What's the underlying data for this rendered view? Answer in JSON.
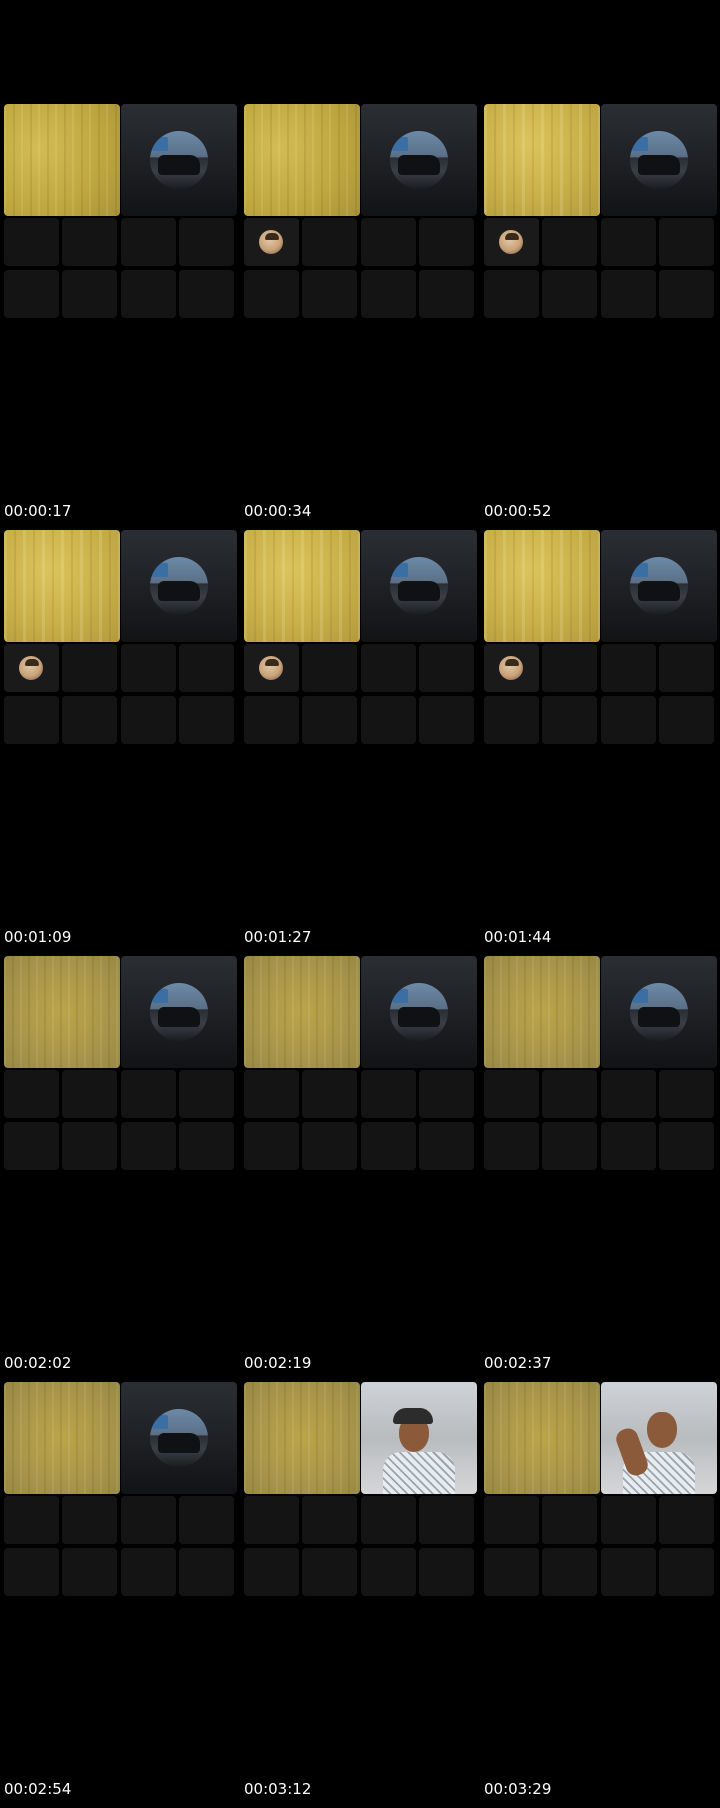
{
  "frames": [
    {
      "timestamp": "00:00:17",
      "remote_view": "avatar",
      "participant_avatar": false
    },
    {
      "timestamp": "00:00:34",
      "remote_view": "avatar",
      "participant_avatar": true
    },
    {
      "timestamp": "00:00:52",
      "remote_view": "avatar",
      "participant_avatar": true
    },
    {
      "timestamp": "00:01:09",
      "remote_view": "avatar",
      "participant_avatar": true
    },
    {
      "timestamp": "00:01:27",
      "remote_view": "avatar",
      "participant_avatar": true
    },
    {
      "timestamp": "00:01:44",
      "remote_view": "avatar",
      "participant_avatar": true
    },
    {
      "timestamp": "00:02:02",
      "remote_view": "avatar",
      "participant_avatar": false
    },
    {
      "timestamp": "00:02:19",
      "remote_view": "avatar",
      "participant_avatar": false
    },
    {
      "timestamp": "00:02:37",
      "remote_view": "avatar",
      "participant_avatar": false
    },
    {
      "timestamp": "00:02:54",
      "remote_view": "avatar",
      "participant_avatar": false
    },
    {
      "timestamp": "00:03:12",
      "remote_view": "camera",
      "participant_avatar": false
    },
    {
      "timestamp": "00:03:29",
      "remote_view": "camera",
      "participant_avatar": false
    }
  ],
  "colors": {
    "background": "#000000",
    "empty_tile": "#141414",
    "curtain": "#c9b24a",
    "timestamp_text": "#ffffff"
  }
}
